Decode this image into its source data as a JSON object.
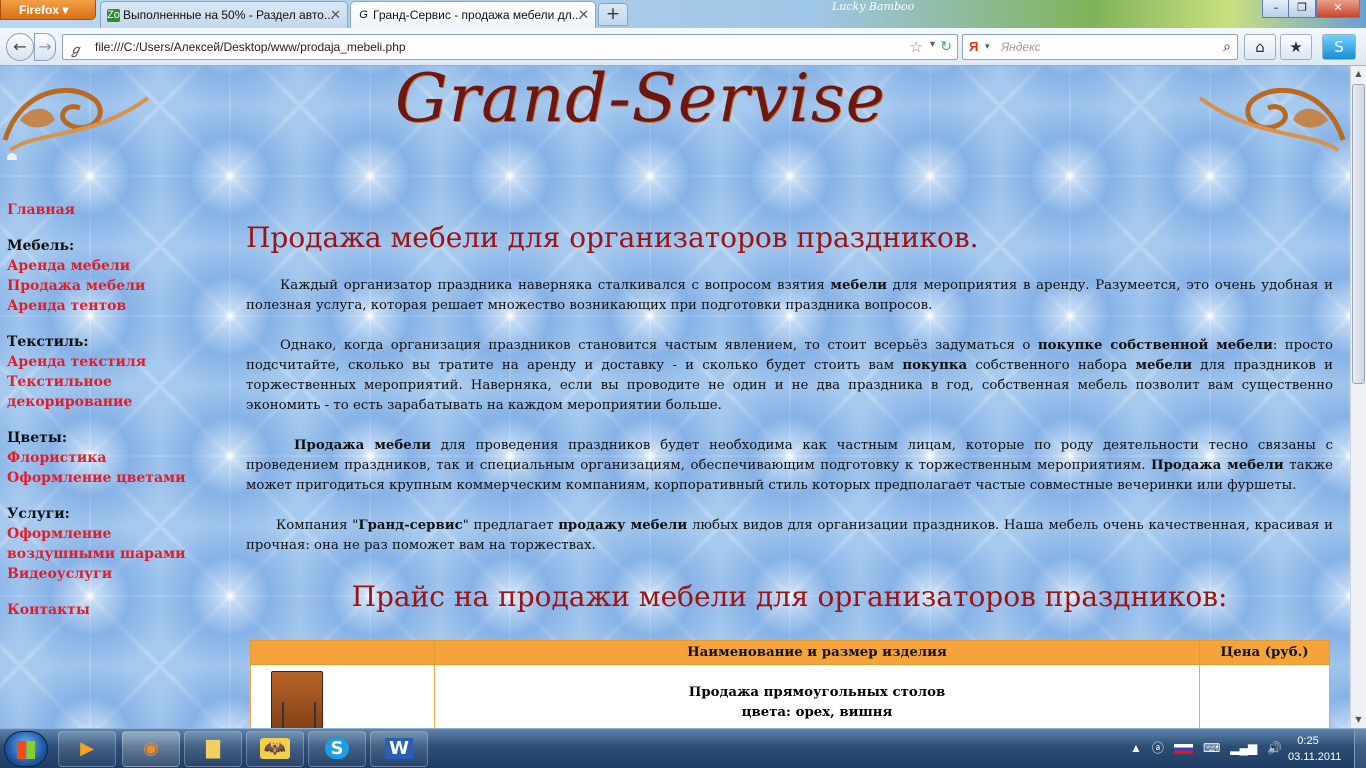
{
  "browser": {
    "app_button": "Firefox",
    "tabs": [
      {
        "label": "Выполненные на 50% - Раздел авто...",
        "icon": "Zo"
      },
      {
        "label": "Гранд-Сервис - продажа мебели дл...",
        "icon": "G"
      }
    ],
    "theme_label": "Lucky Bamboo",
    "url": "file:///C:/Users/Алексей/Desktop/www/prodaja_mebeli.php",
    "search_engine": "Я",
    "search_placeholder": "Яндекс",
    "window_controls": {
      "minimize": "–",
      "maximize": "❐",
      "close": "✕"
    }
  },
  "site": {
    "logo": "Grand-Servise",
    "nav": {
      "home": "Главная",
      "sections": [
        {
          "heading": "Мебель:",
          "links": [
            "Аренда мебели",
            "Продажа мебели",
            "Аренда тентов"
          ]
        },
        {
          "heading": "Текстиль:",
          "links": [
            "Аренда текстиля",
            "Текстильное декорирование"
          ]
        },
        {
          "heading": "Цветы:",
          "links": [
            "Флористика",
            "Оформление цветами"
          ]
        },
        {
          "heading": "Услуги:",
          "links": [
            "Оформление воздушными шарами",
            "Видеоуслуги"
          ]
        }
      ],
      "contacts": "Контакты"
    },
    "title": "Продажа мебели для организаторов праздников.",
    "paragraphs": [
      [
        {
          "t": "Каждый организатор праздника наверняка сталкивался с вопросом взятия "
        },
        {
          "t": "мебели",
          "b": true
        },
        {
          "t": " для мероприятия в аренду. Разумеется, это очень удобная и полезная услуга, которая решает множество возникающих при подготовки праздника вопросов."
        }
      ],
      [
        {
          "t": "Однако, когда организация праздников становится частым явлением, то стоит всерьёз задуматься о "
        },
        {
          "t": "покупке собственной мебели",
          "b": true
        },
        {
          "t": ": просто подсчитайте, сколько вы тратите на аренду и доставку - и сколько будет стоить вам "
        },
        {
          "t": "покупка",
          "b": true
        },
        {
          "t": " собственного набора "
        },
        {
          "t": "мебели",
          "b": true
        },
        {
          "t": " для праздников и торжественных мероприятий. Наверняка, если вы проводите не один и не два праздника в год, собственная мебель позволит вам существенно экономить - то есть зарабатывать на каждом мероприятии больше."
        }
      ],
      [
        {
          "t": "Продажа мебели",
          "b": true
        },
        {
          "t": " для проведения праздников будет необходима как частным лицам, которые по роду деятельности тесно связаны с проведением праздников, так и специальным организациям, обеспечивающим подготовку к торжественным мероприятиям. "
        },
        {
          "t": "Продажа мебели",
          "b": true
        },
        {
          "t": " также может пригодиться крупным коммерческим компаниям, корпоративный стиль которых предполагает частые совместные вечеринки или фуршеты."
        }
      ],
      [
        {
          "t": "Компания \""
        },
        {
          "t": "Гранд-сервис",
          "b": true
        },
        {
          "t": "\" предлагает "
        },
        {
          "t": "продажу мебели",
          "b": true
        },
        {
          "t": " любых видов для организации праздников. Наша мебель очень качественная, красивая и прочная: она не раз поможет вам на торжествах."
        }
      ]
    ],
    "price_title": "Прайс на продажи мебели для организаторов праздников:",
    "price_table": {
      "headers": [
        "",
        "Наименование и размер изделия",
        "Цена (руб.)"
      ],
      "rows": [
        {
          "name_line1": "Продажа прямоугольных столов",
          "name_line2": "цвета: орех, вишня",
          "price": ""
        }
      ]
    }
  },
  "taskbar": {
    "tray_lang": "RU",
    "time": "0:25",
    "date": "03.11.2011"
  }
}
